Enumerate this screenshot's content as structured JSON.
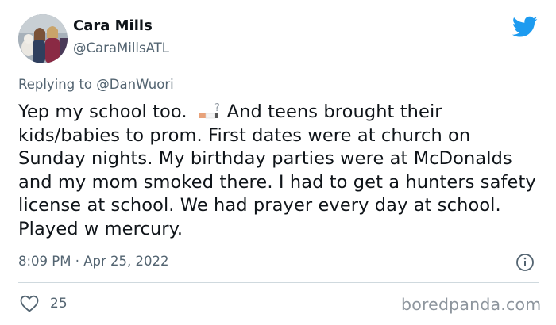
{
  "tweet": {
    "author_name": "Cara Mills",
    "author_handle": "@CaraMillsATL",
    "reply_prefix": "Replying to",
    "reply_to": "@DanWuori",
    "text_part1": "Yep my school too.",
    "text_part2": "And teens brought their kids/babies to prom. First dates were at church on Sunday nights. My birthday parties were at McDonalds and my mom smoked there. I had to get a hunters safety license at school. We had prayer every day at school. Played w mercury.",
    "emoji_name": "cigarette-question-emoji",
    "timestamp": "8:09 PM · Apr 25, 2022",
    "like_count": "25"
  },
  "watermark": "boredpanda.com",
  "colors": {
    "twitter_blue": "#1d9bf0",
    "text": "#0f1419",
    "muted": "#536471"
  }
}
